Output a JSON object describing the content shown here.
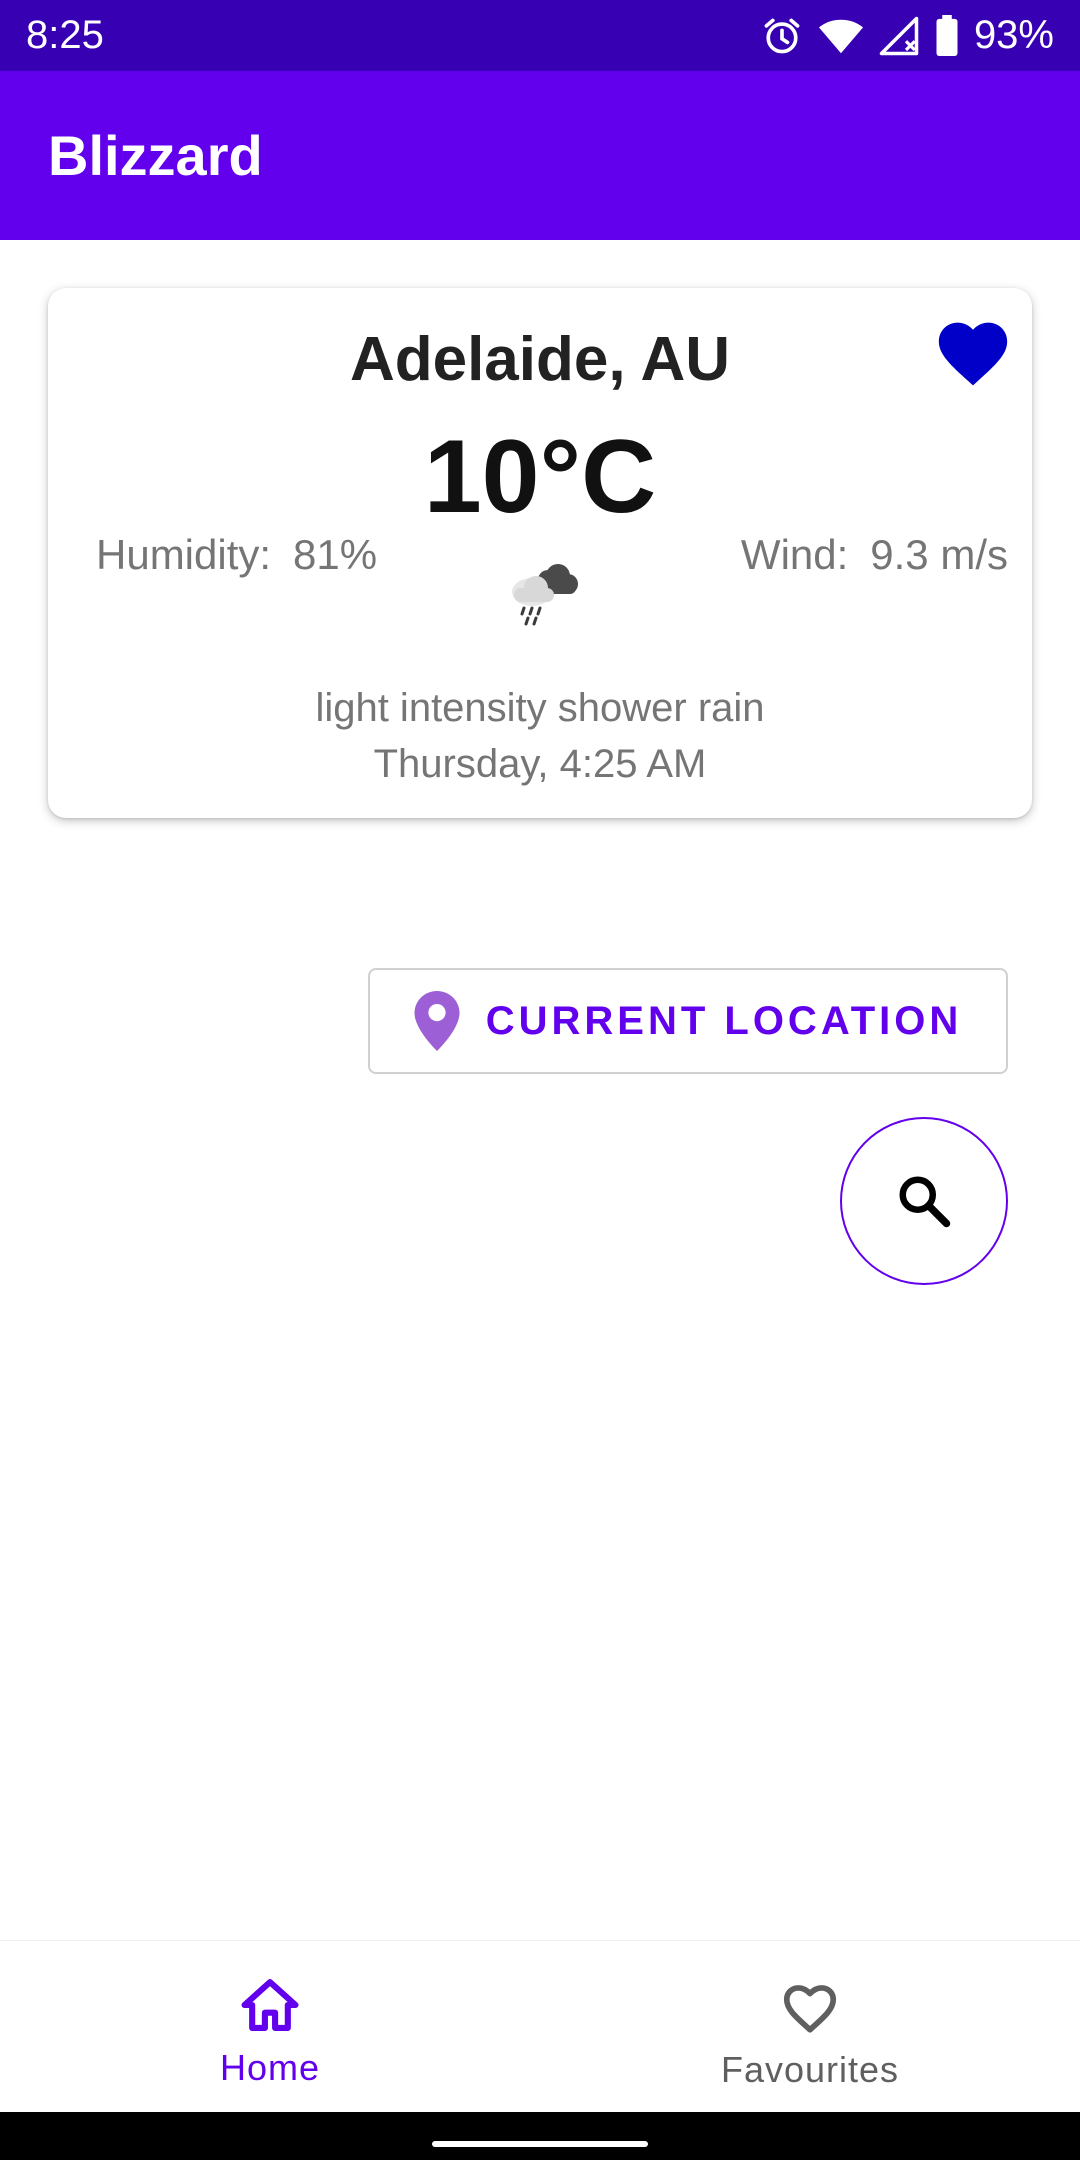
{
  "status_bar": {
    "time": "8:25",
    "battery": "93%",
    "icons": [
      "alarm-icon",
      "wifi-icon",
      "signal-icon",
      "battery-icon"
    ]
  },
  "app_bar": {
    "title": "Blizzard"
  },
  "weather_card": {
    "city": "Adelaide, AU",
    "temperature": "10°C",
    "humidity_label": "Humidity:",
    "humidity_value": "81%",
    "wind_label": "Wind:",
    "wind_value": "9.3 m/s",
    "condition_icon": "shower-rain-icon",
    "description": "light intensity shower rain",
    "datetime": "Thursday, 4:25 AM",
    "favorite_icon": "heart-filled-icon",
    "is_favorite": true
  },
  "location_button": {
    "label": "CURRENT LOCATION",
    "icon": "location-pin-icon"
  },
  "search_button": {
    "icon": "search-icon"
  },
  "bottom_nav": {
    "items": [
      {
        "label": "Home",
        "icon": "home-icon",
        "active": true
      },
      {
        "label": "Favourites",
        "icon": "heart-outline-icon",
        "active": false
      }
    ]
  },
  "colors": {
    "status_bar": "#3700b3",
    "primary": "#6200ee",
    "favorite_heart": "#0000c8",
    "location_pin": "#9c5fd6",
    "secondary_text": "#757575"
  }
}
